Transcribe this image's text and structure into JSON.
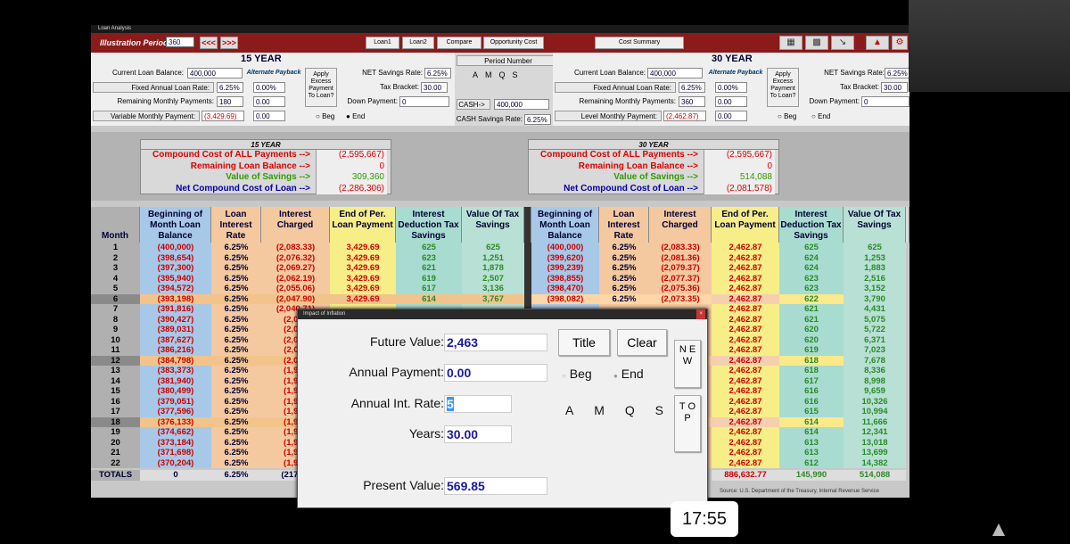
{
  "window_title": "Loan Analysis",
  "toolbar": {
    "illustration_label": "Illustration Period:",
    "illustration_value": "360",
    "prev": "<<<",
    "next": ">>>",
    "tabs": [
      "Loan1",
      "Loan2",
      "Compare",
      "Opportunity Cost"
    ],
    "cost_summary": "Cost Summary"
  },
  "left": {
    "title": "15 YEAR",
    "current_balance_label": "Current Loan Balance:",
    "current_balance": "400,000",
    "alt_payback": "Alternate Payback",
    "fixed_rate_label": "Fixed Annual Loan Rate:",
    "fixed_rate": "6.25%",
    "alt_rate": "0.00%",
    "remaining_label": "Remaining Monthly Payments:",
    "remaining": "180",
    "alt_remaining": "0.00",
    "variable_label": "Variable Monthly Payment:",
    "variable": "(3,429.69)",
    "alt_variable": "0.00",
    "apply": "Apply Excess Payment To Loan?",
    "net_savings_label": "NET Savings Rate:",
    "net_savings": "6.25%",
    "tax_bracket_label": "Tax Bracket:",
    "tax_bracket": "30.00",
    "down_payment_label": "Down Payment:",
    "down_payment": "0",
    "beg": "Beg",
    "end": "End"
  },
  "center": {
    "period_number": "Period Number",
    "periods": [
      "A",
      "M",
      "Q",
      "S"
    ],
    "cash_btn": "CASH->",
    "cash_value": "400,000",
    "cash_rate_label": "CASH Savings Rate:",
    "cash_rate": "6.25%"
  },
  "right": {
    "title": "30 YEAR",
    "current_balance_label": "Current Loan Balance:",
    "current_balance": "400,000",
    "alt_payback": "Alternate Payback",
    "fixed_rate_label": "Fixed Annual Loan Rate:",
    "fixed_rate": "6.25%",
    "alt_rate": "0.00%",
    "remaining_label": "Remaining Monthly Payments:",
    "remaining": "360",
    "alt_remaining": "0.00",
    "variable_label": "Level Monthly Payment:",
    "variable": "(2,462.87)",
    "alt_variable": "0.00",
    "apply": "Apply Excess Payment To Loan?",
    "net_savings_label": "NET Savings Rate:",
    "net_savings": "6.25%",
    "tax_bracket_label": "Tax Bracket:",
    "tax_bracket": "30.00",
    "down_payment_label": "Down Payment:",
    "down_payment": "0",
    "beg": "Beg",
    "end": "End"
  },
  "summary_left": {
    "head": "15 YEAR",
    "rows": [
      {
        "label": "Compound Cost of ALL Payments -->",
        "value": "(2,595,667)"
      },
      {
        "label": "Remaining Loan Balance -->",
        "value": "0"
      },
      {
        "label": "Value of Savings -->",
        "value": "309,360"
      },
      {
        "label": "Net Compound Cost of Loan -->",
        "value": "(2,286,306)"
      }
    ]
  },
  "summary_right": {
    "head": "30 YEAR",
    "rows": [
      {
        "label": "Compound Cost of ALL Payments -->",
        "value": "(2,595,667)"
      },
      {
        "label": "Remaining Loan Balance -->",
        "value": "0"
      },
      {
        "label": "Value of Savings -->",
        "value": "514,088"
      },
      {
        "label": "Net Compound Cost of Loan -->",
        "value": "(2,081,578)"
      }
    ]
  },
  "headers": {
    "month": "Month",
    "h": [
      "Beginning of Month Loan Balance",
      "Loan Interest Rate",
      "Interest Charged",
      "End of Per. Loan Payment",
      "Interest Deduction Tax Savings",
      "Value Of Tax Savings"
    ]
  },
  "rows_left": [
    [
      "1",
      "(400,000)",
      "6.25%",
      "(2,083.33)",
      "3,429.69",
      "625",
      "625"
    ],
    [
      "2",
      "(398,654)",
      "6.25%",
      "(2,076.32)",
      "3,429.69",
      "623",
      "1,251"
    ],
    [
      "3",
      "(397,300)",
      "6.25%",
      "(2,069.27)",
      "3,429.69",
      "621",
      "1,878"
    ],
    [
      "4",
      "(395,940)",
      "6.25%",
      "(2,062.19)",
      "3,429.69",
      "619",
      "2,507"
    ],
    [
      "5",
      "(394,572)",
      "6.25%",
      "(2,055.06)",
      "3,429.69",
      "617",
      "3,136"
    ],
    [
      "6",
      "(393,198)",
      "6.25%",
      "(2,047.90)",
      "3,429.69",
      "614",
      "3,767"
    ],
    [
      "7",
      "(391,816)",
      "6.25%",
      "(2,040.71)",
      "",
      "",
      ""
    ],
    [
      "8",
      "(390,427)",
      "6.25%",
      "(2,033",
      "",
      "",
      ""
    ],
    [
      "9",
      "(389,031)",
      "6.25%",
      "(2,026",
      "",
      "",
      ""
    ],
    [
      "10",
      "(387,627)",
      "6.25%",
      "(2,018",
      "",
      "",
      ""
    ],
    [
      "11",
      "(386,216)",
      "6.25%",
      "(2,011",
      "",
      "",
      ""
    ],
    [
      "12",
      "(384,798)",
      "6.25%",
      "(2,004",
      "",
      "",
      ""
    ],
    [
      "13",
      "(383,373)",
      "6.25%",
      "(1,996",
      "",
      "",
      ""
    ],
    [
      "14",
      "(381,940)",
      "6.25%",
      "(1,989",
      "",
      "",
      ""
    ],
    [
      "15",
      "(380,499)",
      "6.25%",
      "(1,981",
      "",
      "",
      ""
    ],
    [
      "16",
      "(379,051)",
      "6.25%",
      "(1,974",
      "",
      "",
      ""
    ],
    [
      "17",
      "(377,596)",
      "6.25%",
      "(1,966",
      "",
      "",
      ""
    ],
    [
      "18",
      "(376,133)",
      "6.25%",
      "(1,959",
      "",
      "",
      ""
    ],
    [
      "19",
      "(374,662)",
      "6.25%",
      "(1,951",
      "",
      "",
      ""
    ],
    [
      "20",
      "(373,184)",
      "6.25%",
      "(1,943",
      "",
      "",
      ""
    ],
    [
      "21",
      "(371,698)",
      "6.25%",
      "(1,935",
      "",
      "",
      ""
    ],
    [
      "22",
      "(370,204)",
      "6.25%",
      "(1,928",
      "",
      "",
      ""
    ]
  ],
  "rows_right": [
    [
      "(400,000)",
      "6.25%",
      "(2,083.33)",
      "2,462.87",
      "625",
      "625"
    ],
    [
      "(399,620)",
      "6.25%",
      "(2,081.36)",
      "2,462.87",
      "624",
      "1,253"
    ],
    [
      "(399,239)",
      "6.25%",
      "(2,079.37)",
      "2,462.87",
      "624",
      "1,883"
    ],
    [
      "(398,855)",
      "6.25%",
      "(2,077.37)",
      "2,462.87",
      "623",
      "2,516"
    ],
    [
      "(398,470)",
      "6.25%",
      "(2,075.36)",
      "2,462.87",
      "623",
      "3,152"
    ],
    [
      "(398,082)",
      "6.25%",
      "(2,073.35)",
      "2,462.87",
      "622",
      "3,790"
    ],
    [
      "",
      "",
      "",
      "2,462.87",
      "621",
      "4,431"
    ],
    [
      "",
      "",
      "",
      "2,462.87",
      "621",
      "5,075"
    ],
    [
      "",
      "",
      "",
      "2,462.87",
      "620",
      "5,722"
    ],
    [
      "",
      "",
      "",
      "2,462.87",
      "620",
      "6,371"
    ],
    [
      "",
      "",
      "",
      "2,462.87",
      "619",
      "7,023"
    ],
    [
      "",
      "",
      "",
      "2,462.87",
      "618",
      "7,678"
    ],
    [
      "",
      "",
      "",
      "2,462.87",
      "618",
      "8,336"
    ],
    [
      "",
      "",
      "",
      "2,462.87",
      "617",
      "8,998"
    ],
    [
      "",
      "",
      "",
      "2,462.87",
      "616",
      "9,659"
    ],
    [
      "",
      "",
      "",
      "2,462.87",
      "616",
      "10,326"
    ],
    [
      "",
      "",
      "",
      "2,462.87",
      "615",
      "10,994"
    ],
    [
      "",
      "",
      "",
      "2,462.87",
      "614",
      "11,666"
    ],
    [
      "",
      "",
      "",
      "2,462.87",
      "614",
      "12,341"
    ],
    [
      "",
      "",
      "",
      "2,462.87",
      "613",
      "13,018"
    ],
    [
      "",
      "",
      "",
      "2,462.87",
      "613",
      "13,699"
    ],
    [
      "",
      "",
      "",
      "2,462.87",
      "612",
      "14,382"
    ]
  ],
  "totals": {
    "label": "TOTALS",
    "l": [
      "0",
      "6.25%",
      "(217,34"
    ],
    "r": [
      "886,632.77",
      "145,990",
      "514,088"
    ]
  },
  "source": "Source: U.S. Department of the Treasury, Internal Revenue Service",
  "dialog": {
    "title": "Impact of Inflation",
    "fv_label": "Future Value:",
    "fv": "2,463",
    "pmt_label": "Annual Payment:",
    "pmt": "0.00",
    "rate_label": "Annual Int. Rate:",
    "rate": "5",
    "years_label": "Years:",
    "years": "30.00",
    "pv_label": "Present Value:",
    "pv": "569.85",
    "title_btn": "Title",
    "clear_btn": "Clear",
    "new_btn": "N E W",
    "top_btn": "T O P",
    "beg": "Beg",
    "end": "End",
    "periods": [
      "A",
      "M",
      "Q",
      "S"
    ]
  },
  "clock": "17:55"
}
